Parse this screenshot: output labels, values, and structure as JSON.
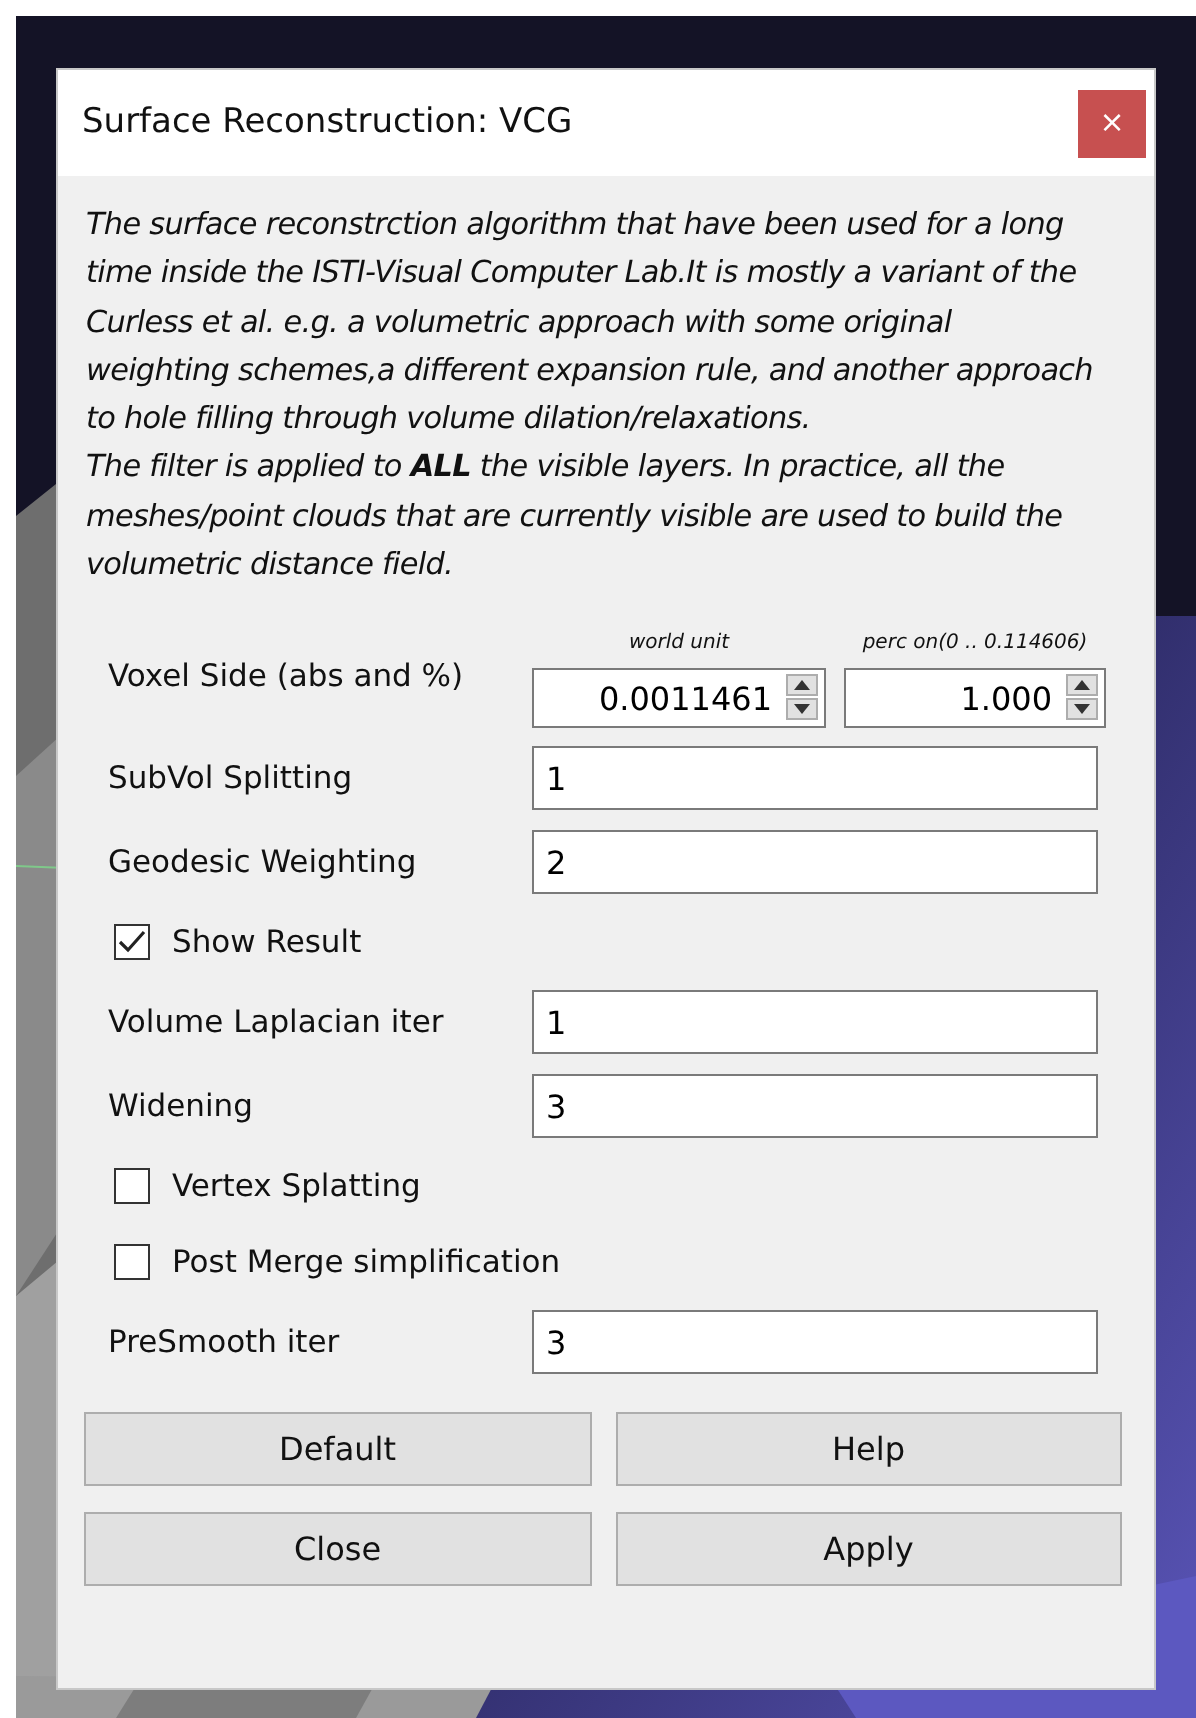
{
  "window": {
    "title": "Surface Reconstruction: VCG",
    "close_label": "×"
  },
  "description": [
    "The surface reconstrction algorithm that have been used for a long time inside the ISTI-Visual Computer Lab.It is mostly a variant of the Curless et al. e.g. a volumetric approach with some original weighting schemes,a different expansion rule, and another approach to hole filling through volume dilation/relaxations.",
    "The filter is applied to **ALL** the visible layers. In practice, all the meshes/point clouds that are currently visible are used to build the volumetric distance field."
  ],
  "params": [
    {
      "kind": "spin_pair",
      "label": "Voxel Side (abs and %)",
      "fields": [
        {
          "caption": "world unit",
          "value": "0.0011461"
        },
        {
          "caption": "perc on(0 .. 0.114606)",
          "value": "1.000"
        }
      ]
    },
    {
      "kind": "text",
      "label": "SubVol Splitting",
      "value": "1"
    },
    {
      "kind": "text",
      "label": "Geodesic Weighting",
      "value": "2"
    },
    {
      "kind": "checkbox",
      "label": "Show Result",
      "checked": true
    },
    {
      "kind": "text",
      "label": "Volume Laplacian iter",
      "value": "1"
    },
    {
      "kind": "text",
      "label": "Widening",
      "value": "3"
    },
    {
      "kind": "checkbox",
      "label": "Vertex Splatting",
      "checked": false
    },
    {
      "kind": "checkbox",
      "label": "Post Merge simplification",
      "checked": false
    },
    {
      "kind": "text",
      "label": "PreSmooth iter",
      "value": "3"
    }
  ],
  "buttons": [
    "Default",
    "Help",
    "Close",
    "Apply"
  ]
}
